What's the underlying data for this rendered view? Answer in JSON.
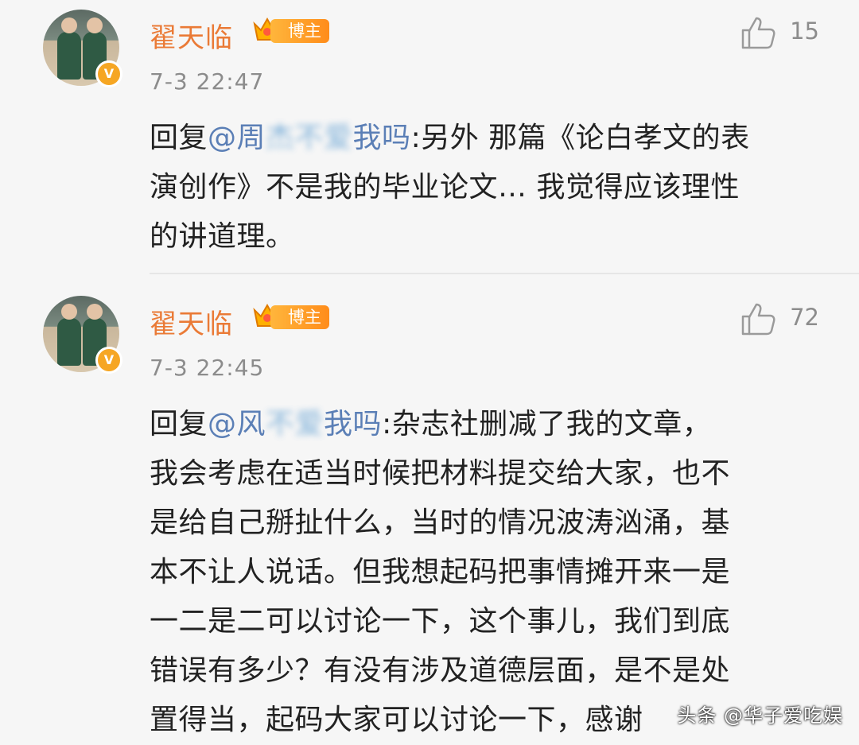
{
  "comments": [
    {
      "user": "翟天临",
      "badge": "博主",
      "time": "7-3 22:47",
      "likes": "15",
      "reply_prefix": "回复",
      "mention_start": "@周",
      "mention_blur": "杰不爱",
      "mention_end": "我吗",
      "lines_first_rest": ":另外  那篇《论白孝文的表",
      "lines": [
        "演创作》不是我的毕业论文… 我觉得应该理性",
        "的讲道理。"
      ]
    },
    {
      "user": "翟天临",
      "badge": "博主",
      "time": "7-3 22:45",
      "likes": "72",
      "reply_prefix": "回复",
      "mention_start": "@风",
      "mention_blur": "不爱",
      "mention_end": "我吗",
      "lines_first_rest": ":杂志社删减了我的文章，",
      "lines": [
        "我会考虑在适当时候把材料提交给大家，也不",
        "是给自己掰扯什么，当时的情况波涛汹涌，基",
        "本不让人说话。但我想起码把事情摊开来一是",
        "一二是二可以讨论一下，这个事儿，我们到底",
        "错误有多少？有没有涉及道德层面，是不是处",
        "置得当，起码大家可以讨论一下，感谢"
      ]
    }
  ],
  "watermark": "头条 @华子爱吃娱",
  "colors": {
    "name": "#ea7a36",
    "mention": "#5b7fb6",
    "badge": "#ff8c1a",
    "meta": "#8c8c8c",
    "background": "#f6f6f6"
  },
  "icons": {
    "like": "thumbs-up-icon",
    "verified": "verified-v-icon",
    "crown": "crown-icon"
  }
}
